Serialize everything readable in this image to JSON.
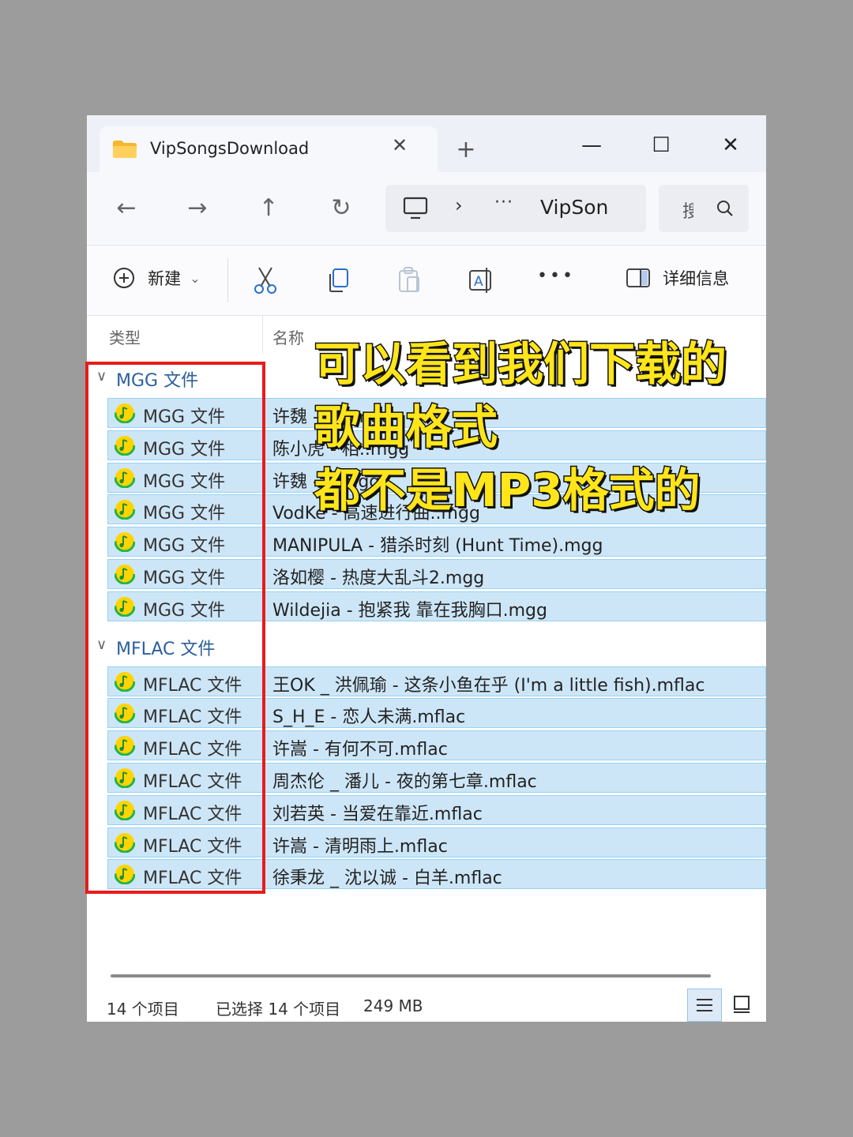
{
  "window": {
    "tab_title": "VipSongsDownload",
    "new_tab": "+",
    "controls": {
      "minimize": "—",
      "maximize": "☐",
      "close": "✕"
    }
  },
  "nav": {
    "back": "←",
    "forward": "→",
    "up": "↑",
    "refresh": "↻",
    "address": {
      "chevron": "›",
      "overflow": "···",
      "crumb": "VipSon"
    },
    "search_placeholder": "搜"
  },
  "toolbar": {
    "new_label": "新建",
    "new_dropdown": "⌄",
    "more": "•••",
    "details_label": "详细信息"
  },
  "columns": {
    "type": "类型",
    "name": "名称"
  },
  "groups": [
    {
      "name": "MGG 文件",
      "rows": [
        {
          "type": "MGG 文件",
          "name": "许魏 - 相..mgg"
        },
        {
          "type": "MGG 文件",
          "name": "陈小虎 - 相..mgg"
        },
        {
          "type": "MGG 文件",
          "name": "许魏 - ...mgg"
        },
        {
          "type": "MGG 文件",
          "name": "VodKe - 高速进行曲..mgg"
        },
        {
          "type": "MGG 文件",
          "name": "MANIPULA - 猎杀时刻 (Hunt Time).mgg"
        },
        {
          "type": "MGG 文件",
          "name": "洛如樱 - 热度大乱斗2.mgg"
        },
        {
          "type": "MGG 文件",
          "name": "Wildejia - 抱紧我 靠在我胸口.mgg"
        }
      ]
    },
    {
      "name": "MFLAC 文件",
      "rows": [
        {
          "type": "MFLAC 文件",
          "name": "王OK _ 洪佩瑜 - 这条小鱼在乎 (I'm a little fish).mflac"
        },
        {
          "type": "MFLAC 文件",
          "name": "S_H_E - 恋人未满.mflac"
        },
        {
          "type": "MFLAC 文件",
          "name": "许嵩 - 有何不可.mflac"
        },
        {
          "type": "MFLAC 文件",
          "name": "周杰伦 _ 潘儿 - 夜的第七章.mflac"
        },
        {
          "type": "MFLAC 文件",
          "name": "刘若英 - 当爱在靠近.mflac"
        },
        {
          "type": "MFLAC 文件",
          "name": "许嵩 - 清明雨上.mflac"
        },
        {
          "type": "MFLAC 文件",
          "name": "徐秉龙 _ 沈以诚 - 白羊.mflac"
        }
      ]
    }
  ],
  "status": {
    "count": "14 个项目",
    "selected": "已选择 14 个项目",
    "size": "249 MB"
  },
  "overlay": {
    "lines": [
      "可以看到我们下载的",
      "歌曲格式",
      "都不是MP3格式的"
    ]
  },
  "colors": {
    "selection": "#cde6f7",
    "selection_border": "#99d1f2",
    "group_text": "#2b5f9e",
    "highlight_box": "#e51c1c",
    "caption": "#ffe51a",
    "icon_green": "#20b548",
    "icon_yellow": "#ffd400"
  }
}
